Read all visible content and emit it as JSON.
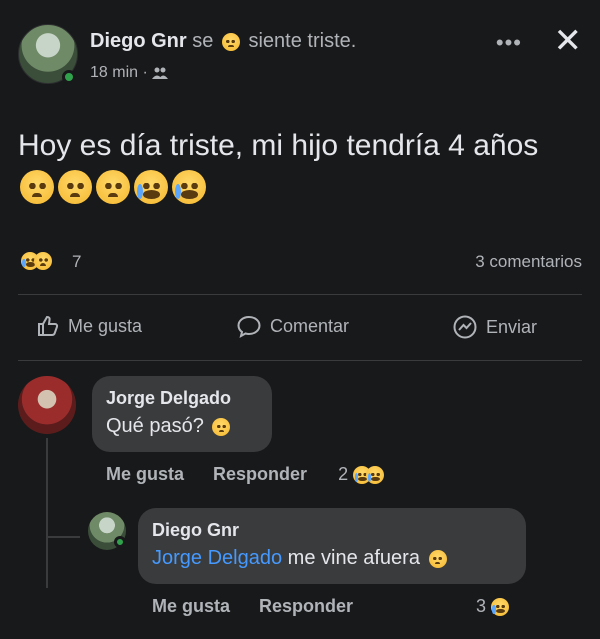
{
  "post": {
    "author": "Diego Gnr",
    "feeling_prefix": "se",
    "feeling": "siente triste.",
    "time": "18 min",
    "separator": "·",
    "more_label": "•••",
    "close_label": "✕",
    "text": "Hoy es día triste, mi hijo tendría 4 años",
    "reaction_count": "7",
    "comments_count": "3 comentarios"
  },
  "actions": {
    "like": "Me gusta",
    "comment": "Comentar",
    "share": "Enviar"
  },
  "comments": [
    {
      "author": "Jorge Delgado",
      "text": "Qué pasó?",
      "like": "Me gusta",
      "reply": "Responder",
      "reaction_count": "2"
    },
    {
      "author": "Diego Gnr",
      "mention": "Jorge Delgado",
      "text": "me vine afuera",
      "like": "Me gusta",
      "reply": "Responder",
      "reaction_count": "3"
    }
  ],
  "colors": {
    "background": "#18191a",
    "bubble": "#3a3b3c",
    "mention": "#4599ff",
    "online": "#31a24c"
  }
}
